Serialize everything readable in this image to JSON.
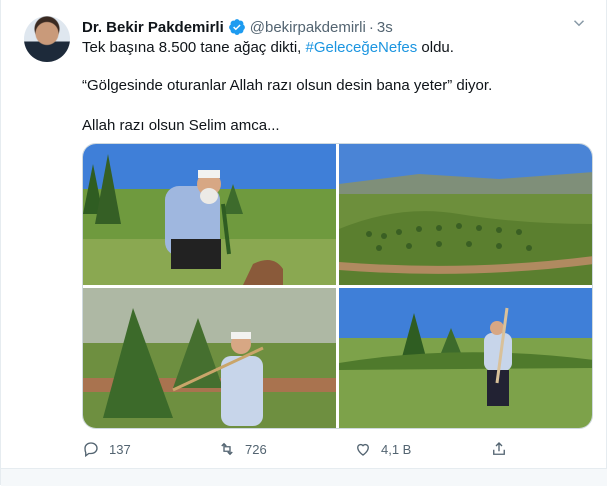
{
  "tweet": {
    "display_name": "Dr. Bekir Pakdemirli",
    "handle": "@bekirpakdemirli",
    "separator": "·",
    "time": "3s",
    "line1_before": "Tek başına 8.500 tane ağaç dikti, ",
    "hashtag": "#GeleceğeNefes",
    "line1_after": " oldu.",
    "line2": "“Gölgesinde oturanlar Allah razı olsun desin bana yeter” diyor.",
    "line3": "Allah razı olsun Selim amca..."
  },
  "actions": {
    "replies": "137",
    "retweets": "726",
    "likes": "4,1 B"
  },
  "colors": {
    "accent": "#1b95e0",
    "muted": "#536471",
    "verified": "#1d9bf0"
  },
  "icons": [
    "verified-badge-icon",
    "chevron-down-icon",
    "reply-icon",
    "retweet-icon",
    "like-icon",
    "share-icon"
  ]
}
